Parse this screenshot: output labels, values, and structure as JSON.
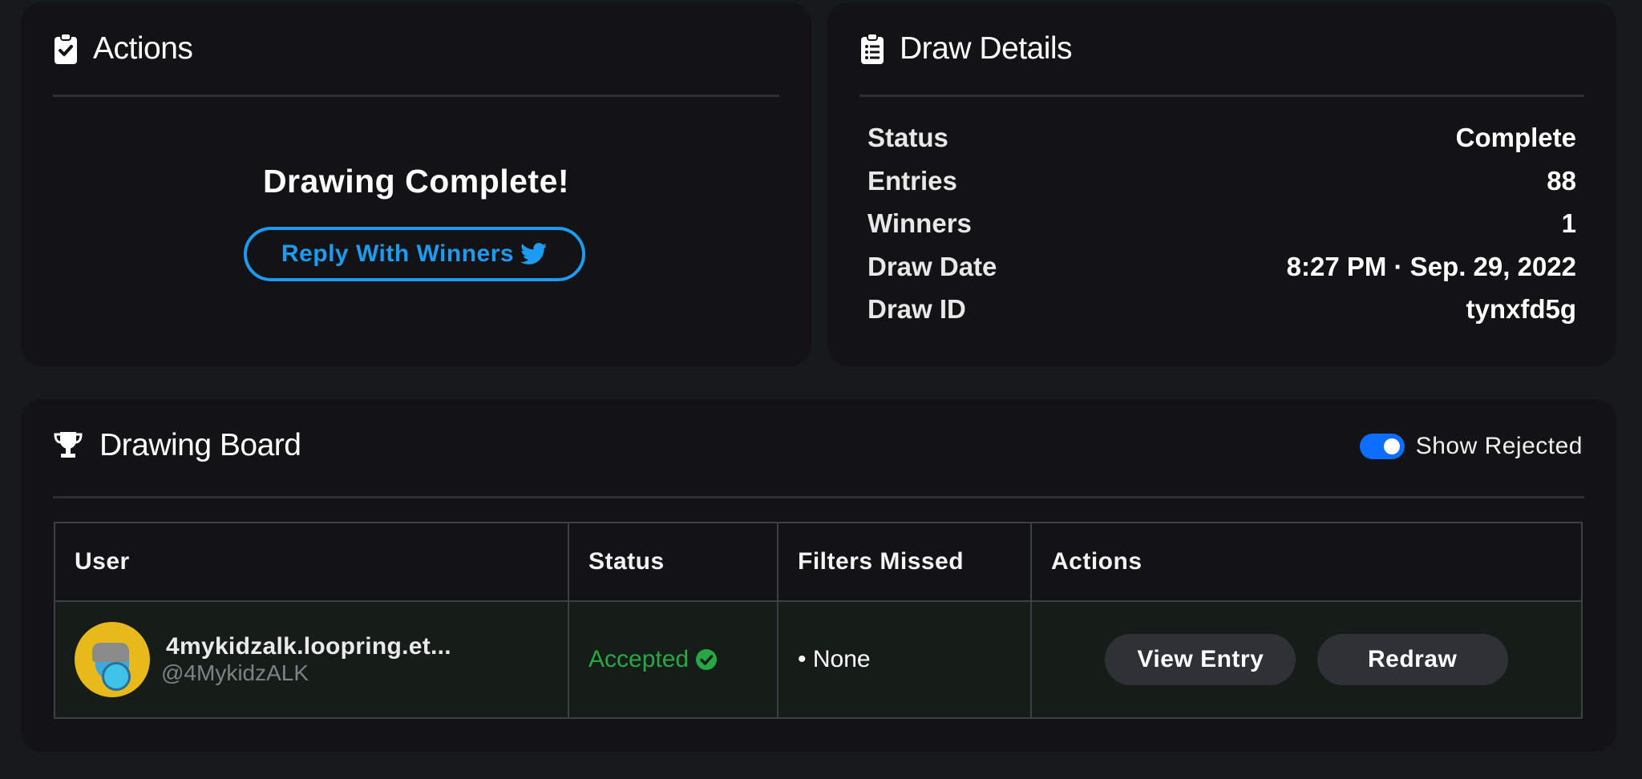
{
  "actions": {
    "title": "Actions",
    "complete_text": "Drawing Complete!",
    "reply_label": "Reply With Winners"
  },
  "details": {
    "title": "Draw Details",
    "rows": [
      {
        "label": "Status",
        "value": "Complete"
      },
      {
        "label": "Entries",
        "value": "88"
      },
      {
        "label": "Winners",
        "value": "1"
      },
      {
        "label": "Draw Date",
        "value": "8:27 PM · Sep. 29, 2022"
      },
      {
        "label": "Draw ID",
        "value": "tynxfd5g"
      }
    ]
  },
  "board": {
    "title": "Drawing Board",
    "toggle_label": "Show Rejected",
    "toggle_on": true,
    "columns": [
      "User",
      "Status",
      "Filters Missed",
      "Actions"
    ],
    "rows": [
      {
        "user_name": "4mykidzalk.loopring.et...",
        "user_handle": "@4MykidzALK",
        "status": "Accepted",
        "filters_missed": "• None",
        "view_label": "View Entry",
        "redraw_label": "Redraw"
      }
    ]
  },
  "colors": {
    "accent_blue": "#1d9bf0",
    "toggle_blue": "#0d6efd",
    "success_green": "#28a745"
  },
  "icons": [
    "clipboard-check-icon",
    "clipboard-list-icon",
    "trophy-icon",
    "twitter-bird-icon",
    "check-circle-icon"
  ]
}
